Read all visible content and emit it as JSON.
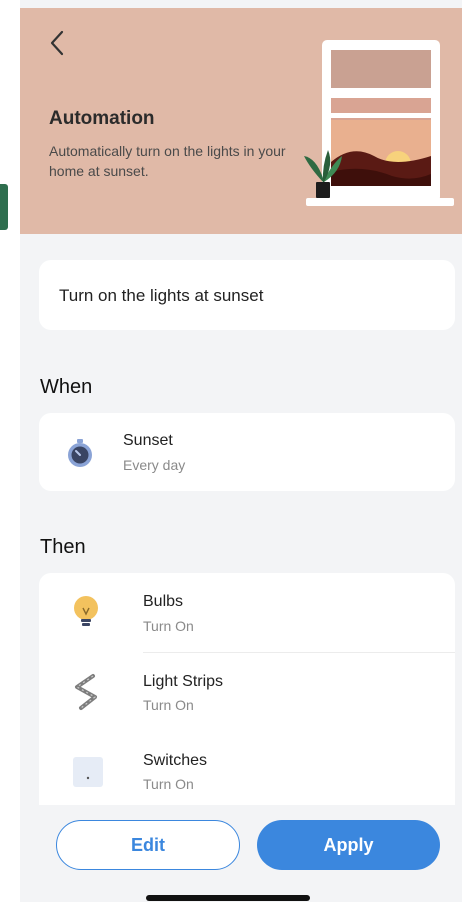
{
  "header": {
    "title": "Automation",
    "description": "Automatically turn on the lights in your home at sunset."
  },
  "automation_name": "Turn on the lights at sunset",
  "when": {
    "label": "When",
    "trigger": {
      "title": "Sunset",
      "subtitle": "Every day"
    }
  },
  "then": {
    "label": "Then",
    "actions": [
      {
        "title": "Bulbs",
        "subtitle": "Turn On",
        "icon": "bulb-icon"
      },
      {
        "title": "Light Strips",
        "subtitle": "Turn On",
        "icon": "light-strip-icon"
      },
      {
        "title": "Switches",
        "subtitle": "Turn On",
        "icon": "switch-icon"
      }
    ]
  },
  "buttons": {
    "edit": "Edit",
    "apply": "Apply"
  },
  "colors": {
    "hero_bg": "#e0b9a7",
    "accent": "#3b87de",
    "page_bg": "#f3f4f6"
  }
}
